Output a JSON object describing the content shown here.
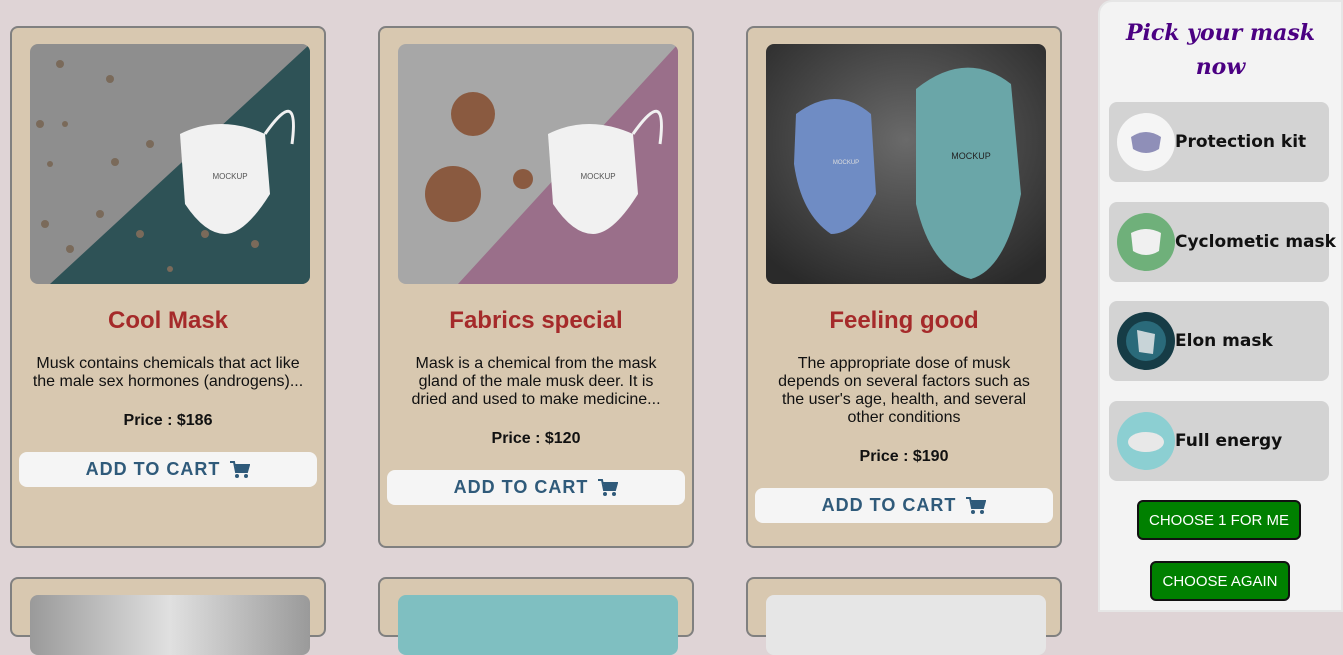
{
  "products": [
    {
      "title": "Cool Mask",
      "desc": "Musk contains chemicals that act like the male sex hormones (androgens)...",
      "price": "Price : $186",
      "cart": "ADD TO CART"
    },
    {
      "title": "Fabrics special",
      "desc": "Mask is a chemical from the mask gland of the male musk deer. It is dried and used to make medicine...",
      "price": "Price : $120",
      "cart": "ADD TO CART"
    },
    {
      "title": "Feeling good",
      "desc": "The appropriate dose of musk depends on several factors such as the user's age, health, and several other conditions",
      "price": "Price : $190",
      "cart": "ADD TO CART"
    }
  ],
  "sidebar": {
    "heading": "Pick your mask now",
    "options": [
      {
        "label": "Protection kit"
      },
      {
        "label": "Cyclometic mask"
      },
      {
        "label": "Elon mask"
      },
      {
        "label": "Full energy"
      }
    ],
    "choose_one": "CHOOSE 1 FOR ME",
    "choose_again": "CHOOSE AGAIN"
  },
  "colors": {
    "page_bg": "#dfd4d6",
    "card_bg": "#d8c8b0",
    "title": "#a52a2a",
    "cart_text": "#2f5a7a",
    "heading": "#4b0082",
    "green_button": "#008000"
  },
  "icons": {
    "cart": "shopping-cart-icon"
  }
}
